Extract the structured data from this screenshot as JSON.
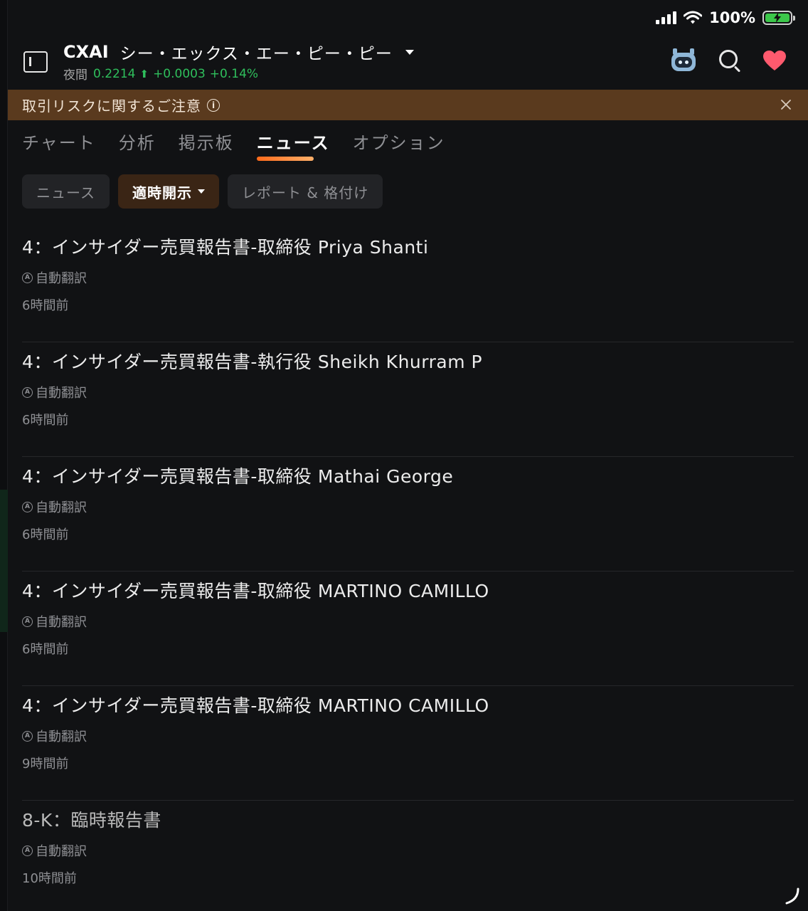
{
  "status_bar": {
    "battery_pct": "100%",
    "colors": {
      "battery_fill": "#3cc74a"
    }
  },
  "header": {
    "ticker": "CXAI",
    "company_name": "シー・エックス・エー・ピー・ピー",
    "session_label": "夜間",
    "price": "0.2214",
    "change": "+0.0003",
    "change_pct": "+0.14%",
    "colors": {
      "positive": "#2fbf5c",
      "favorite": "#ff5a6e"
    }
  },
  "risk_banner": {
    "text": "取引リスクに関するご注意",
    "info_glyph": "i",
    "color": "#5a3a1e"
  },
  "tabs": [
    {
      "label": "チャート",
      "active": false
    },
    {
      "label": "分析",
      "active": false
    },
    {
      "label": "掲示板",
      "active": false
    },
    {
      "label": "ニュース",
      "active": true
    },
    {
      "label": "オプション",
      "active": false
    }
  ],
  "chips": [
    {
      "label": "ニュース",
      "active": false
    },
    {
      "label": "適時開示",
      "active": true
    },
    {
      "label": "レポート & 格付け",
      "active": false
    }
  ],
  "translate_glyph": "A",
  "news": [
    {
      "title": "4：インサイダー売買報告書-取締役 Priya Shanti",
      "translated": "自動翻訳",
      "time": "6時間前"
    },
    {
      "title": "4：インサイダー売買報告書-執行役 Sheikh Khurram P",
      "translated": "自動翻訳",
      "time": "6時間前"
    },
    {
      "title": "4：インサイダー売買報告書-取締役 Mathai George",
      "translated": "自動翻訳",
      "time": "6時間前"
    },
    {
      "title": "4：インサイダー売買報告書-取締役 MARTINO CAMILLO",
      "translated": "自動翻訳",
      "time": "6時間前"
    },
    {
      "title": "4：インサイダー売買報告書-取締役 MARTINO CAMILLO",
      "translated": "自動翻訳",
      "time": "9時間前"
    },
    {
      "title": "8-K：臨時報告書",
      "translated": "自動翻訳",
      "time": "10時間前"
    }
  ]
}
